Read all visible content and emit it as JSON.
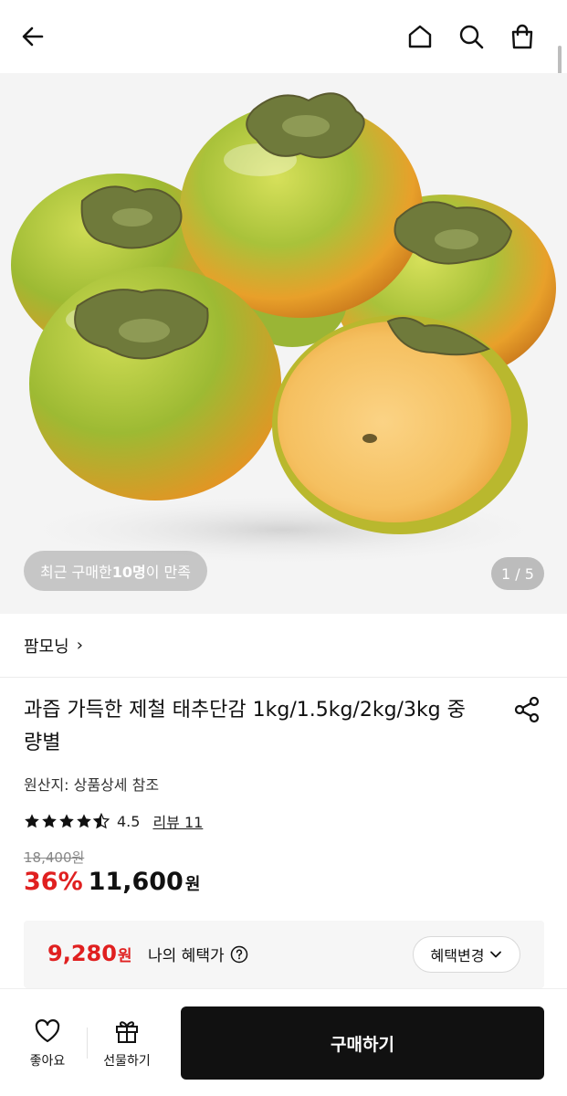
{
  "topbar": {
    "icons": [
      "back-icon",
      "home-icon",
      "search-icon",
      "cart-icon"
    ]
  },
  "hero": {
    "recent_prefix": "최근 구매한 ",
    "recent_count": "10명",
    "recent_suffix": "이 만족",
    "page_indicator": "1 / 5"
  },
  "brand": {
    "name": "팜모닝",
    "chevron": "›"
  },
  "product": {
    "title": "과즙 가득한 제철 태추단감 1kg/1.5kg/2kg/3kg 중량별",
    "origin": "원산지: 상품상세 참조",
    "rating_value": "4.5",
    "rating": 4.5,
    "review_label": "리뷰 11",
    "original_price": "18,400원",
    "discount": "36%",
    "sale_price": "11,600",
    "sale_unit": "원"
  },
  "benefit": {
    "price": "9,280",
    "unit": "원",
    "label": "나의 혜택가",
    "change_button": "혜택변경"
  },
  "bottom_bar": {
    "like_label": "좋아요",
    "gift_label": "선물하기",
    "buy_label": "구매하기"
  },
  "colors": {
    "accent_red": "#e02020",
    "buy_button": "#111111",
    "persimmon_green": "#8fb22c",
    "persimmon_orange": "#f09a24"
  }
}
